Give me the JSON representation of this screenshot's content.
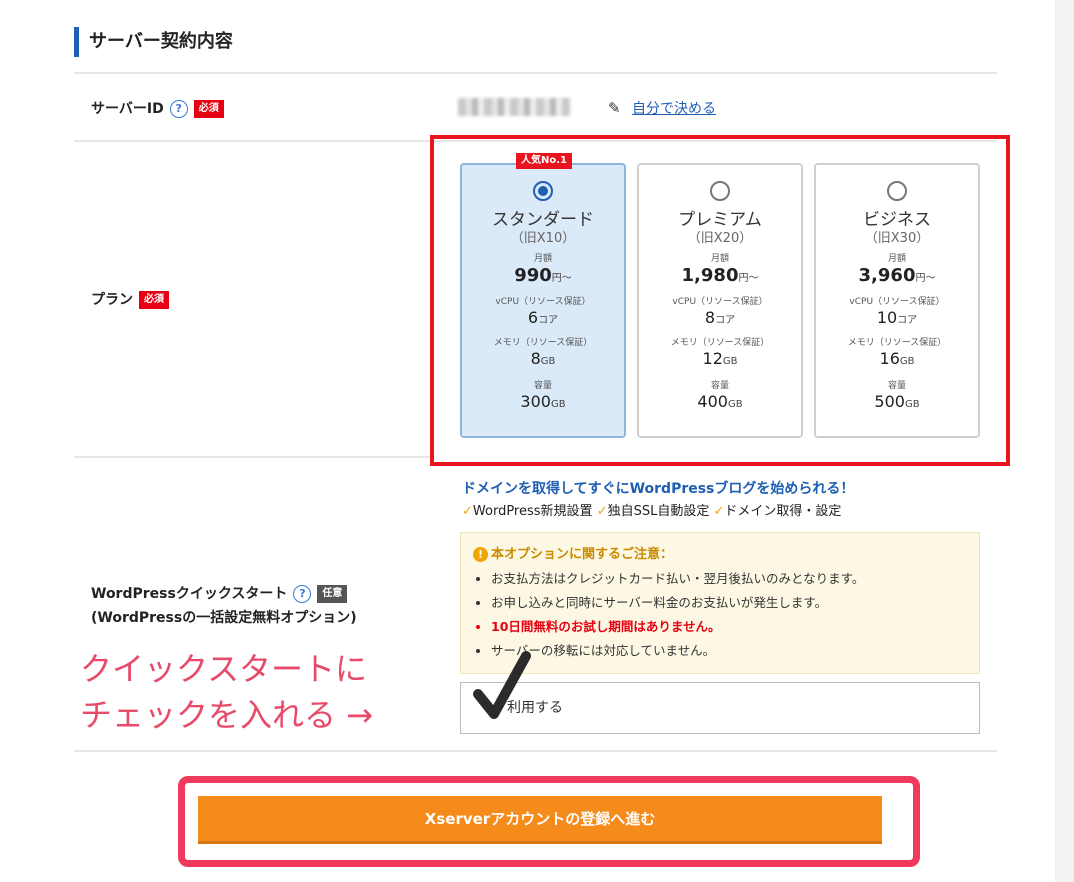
{
  "section": {
    "title": "サーバー契約内容"
  },
  "server_id": {
    "label": "サーバーID",
    "help": "?",
    "required_badge": "必須",
    "self_link": "自分で決める"
  },
  "plan": {
    "label": "プラン",
    "required_badge": "必須",
    "popular_badge": "人気No.1",
    "items": [
      {
        "name": "スタンダード",
        "old": "（旧X10）",
        "monthly_label": "月額",
        "price": "990",
        "price_unit": "円～",
        "vcpu_label": "vCPU（リソース保証）",
        "vcpu": "6",
        "vcpu_unit": "コア",
        "mem_label": "メモリ（リソース保証）",
        "mem": "8",
        "mem_unit": "GB",
        "storage_label": "容量",
        "storage": "300",
        "storage_unit": "GB",
        "selected": true
      },
      {
        "name": "プレミアム",
        "old": "（旧X20）",
        "monthly_label": "月額",
        "price": "1,980",
        "price_unit": "円～",
        "vcpu_label": "vCPU（リソース保証）",
        "vcpu": "8",
        "vcpu_unit": "コア",
        "mem_label": "メモリ（リソース保証）",
        "mem": "12",
        "mem_unit": "GB",
        "storage_label": "容量",
        "storage": "400",
        "storage_unit": "GB",
        "selected": false
      },
      {
        "name": "ビジネス",
        "old": "（旧X30）",
        "monthly_label": "月額",
        "price": "3,960",
        "price_unit": "円～",
        "vcpu_label": "vCPU（リソース保証）",
        "vcpu": "10",
        "vcpu_unit": "コア",
        "mem_label": "メモリ（リソース保証）",
        "mem": "16",
        "mem_unit": "GB",
        "storage_label": "容量",
        "storage": "500",
        "storage_unit": "GB",
        "selected": false
      }
    ]
  },
  "wordpress": {
    "label_line1": "WordPressクイックスタート",
    "label_line2": "(WordPressの一括設定無料オプション)",
    "help": "?",
    "optional_badge": "任意",
    "headline": "ドメインを取得してすぐにWordPressブログを始められる！",
    "features": [
      "WordPress新規設置",
      "独自SSL自動設定",
      "ドメイン取得・設定"
    ],
    "notice": {
      "title": "本オプションに関するご注意：",
      "items": [
        {
          "text": "お支払方法はクレジットカード払い・翌月後払いのみとなります。",
          "emphasis": false
        },
        {
          "text": "お申し込みと同時にサーバー料金のお支払いが発生します。",
          "emphasis": false
        },
        {
          "text": "10日間無料のお試し期間はありません。",
          "emphasis": true
        },
        {
          "text": "サーバーの移転には対応していません。",
          "emphasis": false
        }
      ]
    },
    "use_label": "利用する",
    "checked": true
  },
  "annotation": {
    "line1": "クイックスタートに",
    "line2": "チェックを入れる →"
  },
  "cta": {
    "label": "Xserverアカウントの登録へ進む"
  },
  "colors": {
    "accent_blue": "#1f5fb3",
    "required_red": "#e60012",
    "cta_orange": "#f58b1a",
    "highlight_red": "#e8141e",
    "annotation_pink": "#e84a6a"
  }
}
